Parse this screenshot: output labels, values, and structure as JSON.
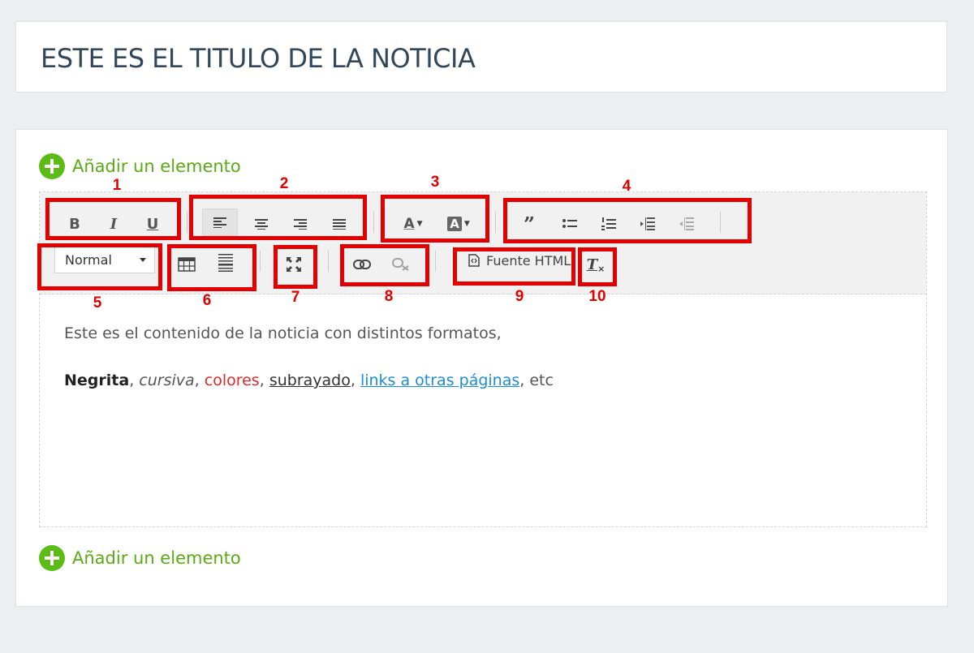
{
  "title": "ESTE ES EL TITULO DE LA NOTICIA",
  "add_element_label": "Añadir un elemento",
  "toolbar": {
    "basic": [
      {
        "icon": "bold-icon",
        "glyph": "B"
      },
      {
        "icon": "italic-icon",
        "glyph": "I"
      },
      {
        "icon": "underline-icon",
        "glyph": "U"
      }
    ],
    "align": [
      "align-left-icon",
      "align-center-icon",
      "align-right-icon",
      "align-justify-icon"
    ],
    "colors": [
      {
        "icon": "text-color-icon",
        "glyph": "A"
      },
      {
        "icon": "background-color-icon",
        "glyph": "A"
      }
    ],
    "paragraph": [
      "blockquote-icon",
      "bulleted-list-icon",
      "numbered-list-icon",
      "indent-icon",
      "outdent-icon"
    ],
    "format_value": "Normal",
    "table": [
      "table-icon",
      "horizontal-rule-icon"
    ],
    "maximize_icon": "maximize-icon",
    "link": [
      "link-icon",
      "unlink-icon"
    ],
    "source_label": "Fuente HTML",
    "remove_format_icon": "remove-format-icon"
  },
  "annotations": [
    "1",
    "2",
    "3",
    "4",
    "5",
    "6",
    "7",
    "8",
    "9",
    "10"
  ],
  "content": {
    "line1": "Este es el contenido de la noticia con distintos formatos,",
    "bold": "Negrita",
    "sep1": ", ",
    "italic": "cursiva",
    "sep2": ", ",
    "red": "colores",
    "sep3": ", ",
    "underline": "subrayado",
    "sep4": ", ",
    "link": "links a otras páginas",
    "tail": ", etc"
  },
  "colors": {
    "accent_green": "#5dbb17",
    "annotation_red": "#e20000",
    "link_blue": "#1c8ed1"
  }
}
